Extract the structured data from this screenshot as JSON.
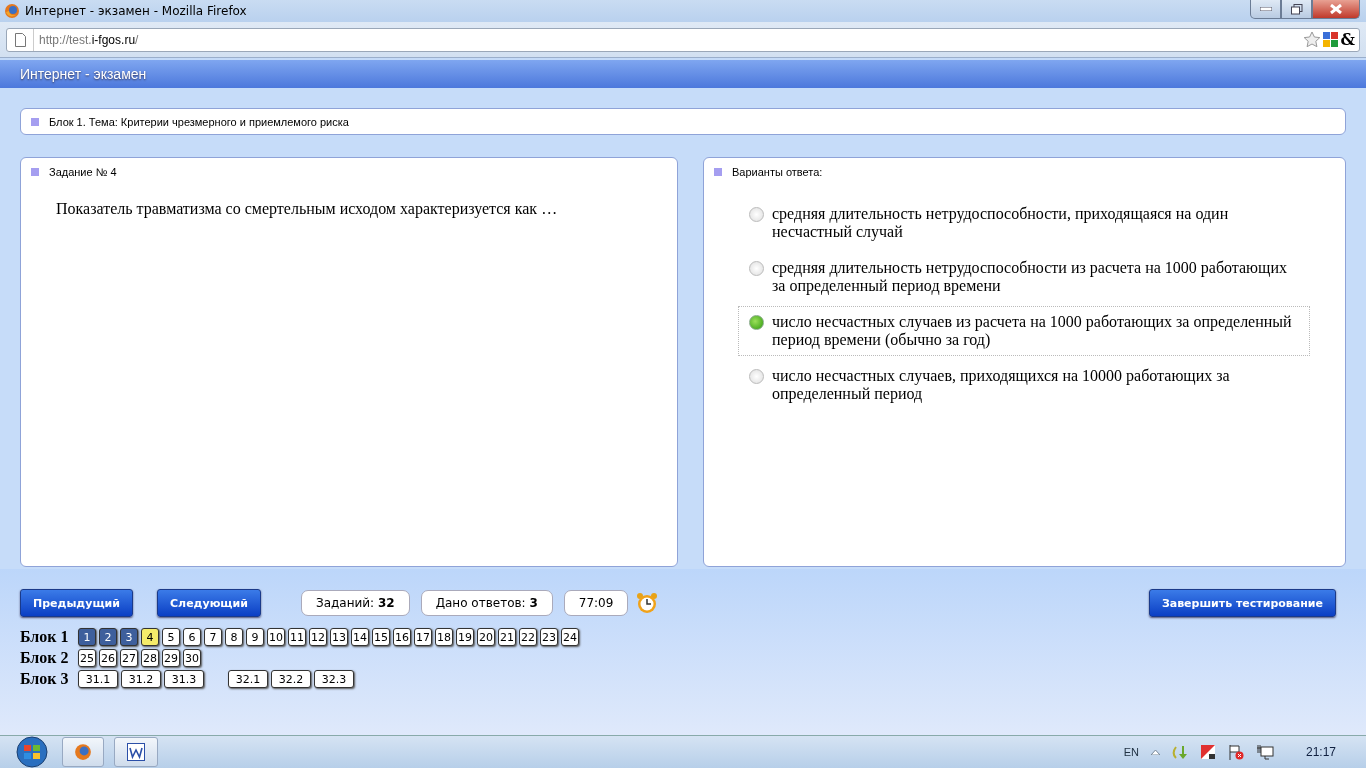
{
  "window": {
    "title": "Интернет - экзамен - Mozilla Firefox"
  },
  "browser": {
    "url_prefix": "http://test.",
    "url_domain": "i-fgos.ru",
    "url_suffix": "/",
    "toolbar_glyph": "&"
  },
  "page_header": {
    "title": "Интернет - экзамен"
  },
  "topic": {
    "text": "Блок 1. Тема: Критерии чрезмерного и приемлемого риска"
  },
  "task": {
    "heading": "Задание № 4",
    "question": "Показатель травматизма со смертельным исходом характеризуется как …"
  },
  "answers": {
    "heading": "Варианты ответа:",
    "options": [
      {
        "text": "средняя длительность нетрудоспособности, приходящаяся на один несчастный случай",
        "selected": false
      },
      {
        "text": "средняя длительность нетрудоспособности из расчета на 1000 работающих за определенный период времени",
        "selected": false
      },
      {
        "text": "число несчастных случаев из расчета на 1000 работающих за определенный период времени (обычно за год)",
        "selected": true
      },
      {
        "text": "число несчастных случаев, приходящихся на 10000 работающих за определенный период",
        "selected": false
      }
    ]
  },
  "controls": {
    "prev": "Предыдущий",
    "next": "Следующий",
    "tasks": "Заданий: **32**",
    "answered": "Дано ответов: **3**",
    "timer": "77:09",
    "finish": "Завершить тестирование"
  },
  "blocks": [
    {
      "label": "Блок 1",
      "groups": [
        [
          {
            "n": "1",
            "answered": true,
            "current": false
          },
          {
            "n": "2",
            "answered": true,
            "current": false
          },
          {
            "n": "3",
            "answered": true,
            "current": false
          },
          {
            "n": "4",
            "answered": false,
            "current": true
          },
          {
            "n": "5",
            "answered": false,
            "current": false
          },
          {
            "n": "6",
            "answered": false,
            "current": false
          },
          {
            "n": "7",
            "answered": false,
            "current": false
          },
          {
            "n": "8",
            "answered": false,
            "current": false
          },
          {
            "n": "9",
            "answered": false,
            "current": false
          },
          {
            "n": "10",
            "answered": false,
            "current": false
          },
          {
            "n": "11",
            "answered": false,
            "current": false
          },
          {
            "n": "12",
            "answered": false,
            "current": false
          },
          {
            "n": "13",
            "answered": false,
            "current": false
          },
          {
            "n": "14",
            "answered": false,
            "current": false
          },
          {
            "n": "15",
            "answered": false,
            "current": false
          },
          {
            "n": "16",
            "answered": false,
            "current": false
          },
          {
            "n": "17",
            "answered": false,
            "current": false
          },
          {
            "n": "18",
            "answered": false,
            "current": false
          },
          {
            "n": "19",
            "answered": false,
            "current": false
          },
          {
            "n": "20",
            "answered": false,
            "current": false
          },
          {
            "n": "21",
            "answered": false,
            "current": false
          },
          {
            "n": "22",
            "answered": false,
            "current": false
          },
          {
            "n": "23",
            "answered": false,
            "current": false
          },
          {
            "n": "24",
            "answered": false,
            "current": false
          }
        ]
      ]
    },
    {
      "label": "Блок 2",
      "groups": [
        [
          {
            "n": "25",
            "answered": false,
            "current": false
          },
          {
            "n": "26",
            "answered": false,
            "current": false
          },
          {
            "n": "27",
            "answered": false,
            "current": false
          },
          {
            "n": "28",
            "answered": false,
            "current": false
          },
          {
            "n": "29",
            "answered": false,
            "current": false
          },
          {
            "n": "30",
            "answered": false,
            "current": false
          }
        ]
      ]
    },
    {
      "label": "Блок 3",
      "groups": [
        [
          {
            "n": "31.1",
            "answered": false,
            "current": false
          },
          {
            "n": "31.2",
            "answered": false,
            "current": false
          },
          {
            "n": "31.3",
            "answered": false,
            "current": false
          }
        ],
        [
          {
            "n": "32.1",
            "answered": false,
            "current": false
          },
          {
            "n": "32.2",
            "answered": false,
            "current": false
          },
          {
            "n": "32.3",
            "answered": false,
            "current": false
          }
        ]
      ]
    }
  ],
  "taskbar": {
    "language": "EN",
    "clock": "21:17"
  }
}
